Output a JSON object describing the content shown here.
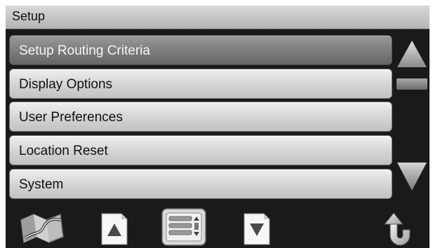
{
  "header": {
    "title": "Setup"
  },
  "menu": {
    "items": [
      {
        "label": "Setup Routing Criteria"
      },
      {
        "label": "Display Options"
      },
      {
        "label": "User Preferences"
      },
      {
        "label": "Location Reset"
      },
      {
        "label": "System"
      }
    ],
    "selected_index": 0
  },
  "scrollbar": {
    "up_icon": "triangle-up",
    "down_icon": "triangle-down",
    "thumb": "scroll-thumb"
  },
  "toolbar": {
    "icons": [
      "map-icon",
      "page-up-icon",
      "menu-list-icon",
      "page-down-icon",
      "back-icon"
    ]
  },
  "colors": {
    "background": "#1a1a1a",
    "button": "#d3d3d3",
    "selected_button": "#7b7b7b",
    "titlebar": "#c6c6c6"
  }
}
